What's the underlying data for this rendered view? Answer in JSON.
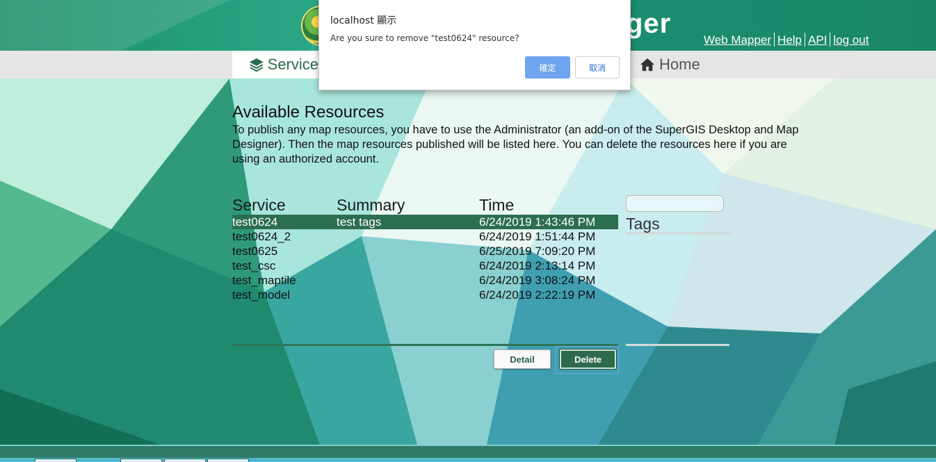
{
  "header": {
    "app_title": "ger",
    "links": [
      "Web Mapper",
      "Help",
      "API",
      "log out"
    ]
  },
  "nav": {
    "service_label": "Service",
    "home_label": "Home"
  },
  "main": {
    "heading": "Available Resources",
    "description": "To publish any map resources, you have to use the Administrator (an add-on of the SuperGIS Desktop and Map Designer). Then the map resources published will be listed here. You can delete the resources here if you are using an authorized account."
  },
  "table": {
    "columns": [
      "Service",
      "Summary",
      "Time"
    ],
    "rows": [
      {
        "service": "test0624",
        "summary": "test tags",
        "time": "6/24/2019 1:43:46 PM",
        "selected": true
      },
      {
        "service": "test0624_2",
        "summary": "",
        "time": "6/24/2019 1:51:44 PM",
        "selected": false
      },
      {
        "service": "test0625",
        "summary": "",
        "time": "6/25/2019 7:09:20 PM",
        "selected": false
      },
      {
        "service": "test_csc",
        "summary": "",
        "time": "6/24/2019 2:13:14 PM",
        "selected": false
      },
      {
        "service": "test_maptile",
        "summary": "",
        "time": "6/24/2019 3:08:24 PM",
        "selected": false
      },
      {
        "service": "test_model",
        "summary": "",
        "time": "6/24/2019 2:22:19 PM",
        "selected": false
      }
    ]
  },
  "tags": {
    "title": "Tags",
    "search_value": ""
  },
  "buttons": {
    "detail": "Detail",
    "delete": "Delete"
  },
  "dialog": {
    "title": "localhost 顯示",
    "message": "Are you sure to remove \"test0624\" resource?",
    "ok_label": "確定",
    "cancel_label": "取消"
  },
  "colors": {
    "accent": "#2c6e50",
    "header": "#22a080",
    "dialog_ok": "#6fa4ee"
  }
}
